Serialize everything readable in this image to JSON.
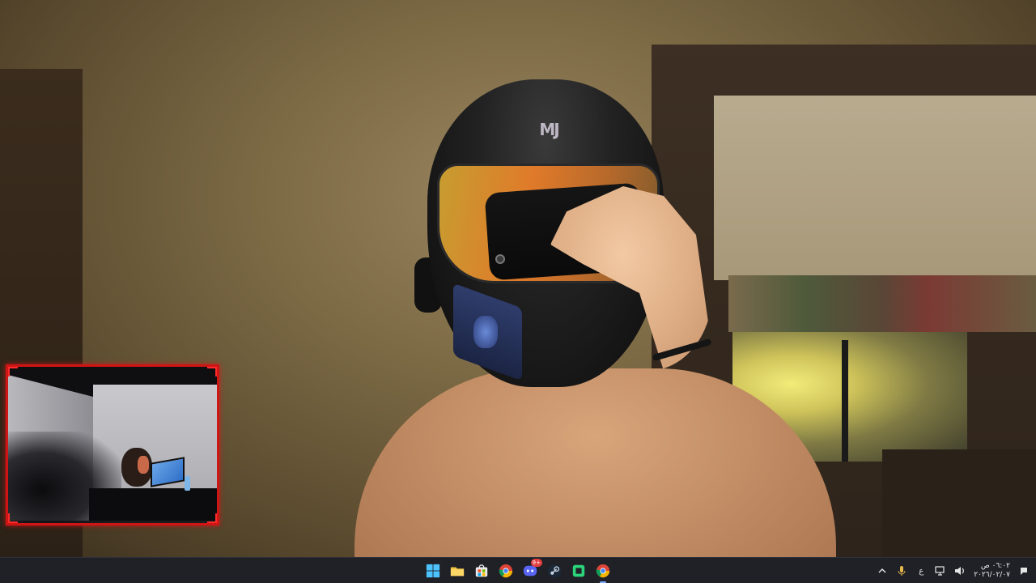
{
  "main_view": {
    "helmet_logo_text": "MJ",
    "camera_icon": "webcam-feed"
  },
  "pip": {
    "border_color": "#d01515",
    "icon": "webcam-feed"
  },
  "taskbar": {
    "apps": [
      {
        "name": "start",
        "icon": "windows-start-icon",
        "active": false
      },
      {
        "name": "file-explorer",
        "icon": "folder-icon",
        "active": false
      },
      {
        "name": "microsoft-store",
        "icon": "store-icon",
        "active": false
      },
      {
        "name": "chrome",
        "icon": "chrome-icon",
        "active": false
      },
      {
        "name": "discord",
        "icon": "discord-icon",
        "active": false,
        "badge": "9+"
      },
      {
        "name": "steam",
        "icon": "steam-icon",
        "active": false
      },
      {
        "name": "green-app",
        "icon": "green-app-icon",
        "active": false
      },
      {
        "name": "chrome-active",
        "icon": "chrome-icon",
        "active": true
      }
    ],
    "tray": {
      "overflow_icon": "chevron-up-icon",
      "mic_icon": "microphone-icon",
      "language": "ع",
      "network_icon": "network-icon",
      "volume_icon": "volume-icon",
      "time": "٠٦:٠٢ ص",
      "date": "٢٠٢٦/٠٢/٠٧",
      "notifications_icon": "notification-icon"
    }
  },
  "colors": {
    "taskbar_bg": "#1f2127",
    "pip_border": "#d01515",
    "active_indicator": "#7aa9ff"
  }
}
